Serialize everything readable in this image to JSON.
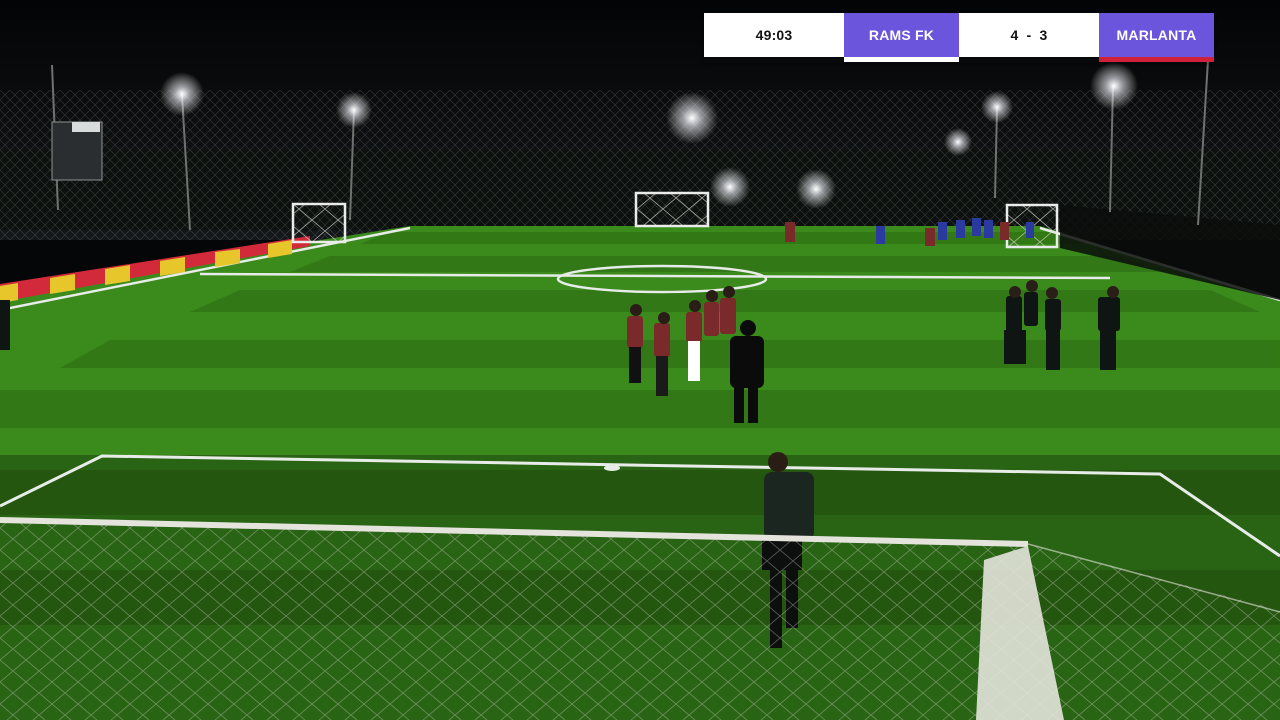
{
  "scoreboard": {
    "time": "49:03",
    "home_team": "RAMS FK",
    "score": "4 - 3",
    "away_team": "MARLANTA",
    "colors": {
      "team_bg": "#6a55dc",
      "home_underline": "#ffffff",
      "away_underline": "#d0213a",
      "panel_bg": "#ffffff"
    }
  },
  "scene": {
    "description_icon": "football-pitch-night",
    "colors": {
      "grass_light": "#3f8a1f",
      "grass_dark": "#2e6d16",
      "line": "#e8ece8",
      "sky": "#050608",
      "home_kit": "#7a2a2a",
      "away_kit": "#2a3aa0",
      "referee_kit": "#0f1513",
      "barrier_red": "#c8283a",
      "barrier_yellow": "#e6c62a"
    }
  }
}
